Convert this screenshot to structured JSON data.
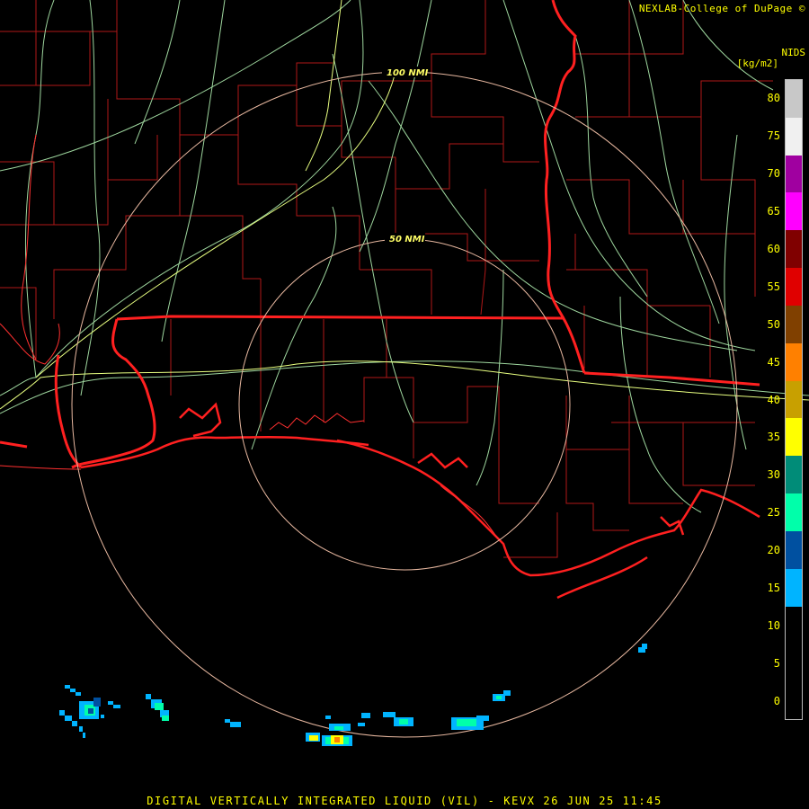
{
  "header": {
    "credit": "NEXLAB-College of DuPage ©",
    "product_code": "NIDS",
    "units": "[kg/m2]"
  },
  "range_rings": [
    {
      "label": "50 NMI"
    },
    {
      "label": "100 NMI"
    }
  ],
  "legend": {
    "ticks": [
      "80",
      "75",
      "70",
      "65",
      "60",
      "55",
      "50",
      "45",
      "40",
      "35",
      "30",
      "25",
      "20",
      "15",
      "10",
      "5",
      "0"
    ],
    "colors": [
      "#c8c8c8",
      "#f0f0f0",
      "#a000a0",
      "#ff00ff",
      "#800000",
      "#e00000",
      "#804000",
      "#ff8000",
      "#c8a000",
      "#ffff00",
      "#008c78",
      "#00ffaa",
      "#0050a0",
      "#00b4ff",
      "#000000",
      "#000000",
      "#000000"
    ]
  },
  "footer": {
    "title": "DIGITAL VERTICALLY INTEGRATED LIQUID (VIL) - KEVX 26 JUN 25 11:45"
  },
  "map_layers": {
    "county_color": "#c02020",
    "state_color": "#ff2020",
    "highway_color": "#a8e8a8",
    "interstate_color": "#e8ff80",
    "ring_color": "#e8b8a0",
    "echo_colors": [
      "#00b4ff",
      "#00ffaa",
      "#ffff00",
      "#ff8000",
      "#0050a0"
    ]
  }
}
